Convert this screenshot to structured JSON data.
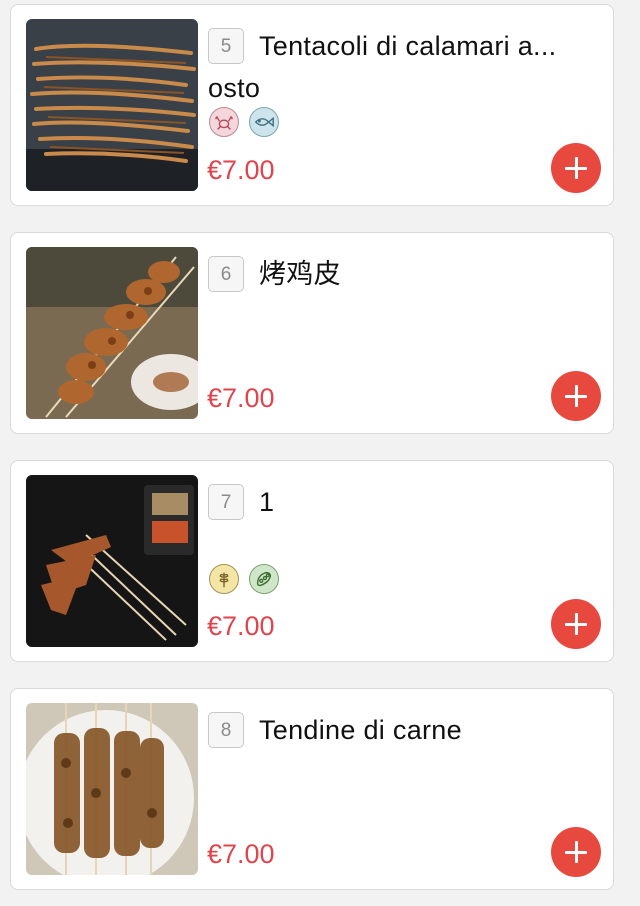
{
  "colors": {
    "price": "#e0454d",
    "add_button": "#e8493f",
    "card_border": "#d9d9d9"
  },
  "items": [
    {
      "number": "5",
      "name": "Tentacoli di calamari a...\nosto",
      "price": "€7.00",
      "allergens": [
        "crustacean-icon",
        "fish-icon"
      ]
    },
    {
      "number": "6",
      "name": "烤鸡皮",
      "price": "€7.00",
      "allergens": []
    },
    {
      "number": "7",
      "name": "1",
      "price": "€7.00",
      "allergens": [
        "gluten-icon",
        "soy-icon"
      ]
    },
    {
      "number": "8",
      "name": "Tendine di carne",
      "price": "€7.00",
      "allergens": []
    }
  ]
}
